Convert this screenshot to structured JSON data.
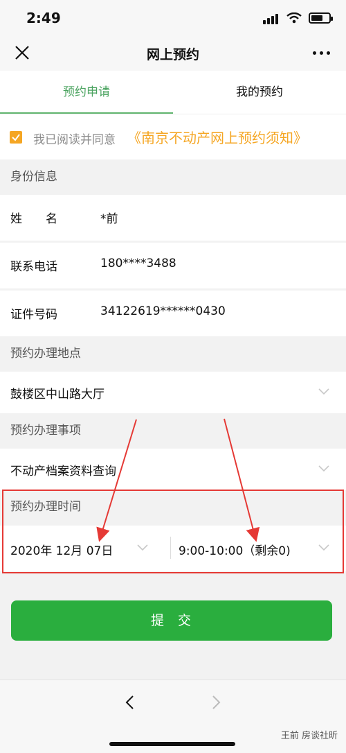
{
  "status": {
    "time": "2:49"
  },
  "navbar": {
    "title": "网上预约"
  },
  "tabs": [
    {
      "label": "预约申请"
    },
    {
      "label": "我的预约"
    }
  ],
  "agreement": {
    "label": "我已阅读并同意",
    "link": "《南京不动产网上预约须知》"
  },
  "identity": {
    "section": "身份信息",
    "name": {
      "label": "姓　　名",
      "value": "*前"
    },
    "phone": {
      "label": "联系电话",
      "value": "180****3488"
    },
    "id": {
      "label": "证件号码",
      "value": "34122619******0430"
    }
  },
  "location": {
    "section": "预约办理地点",
    "value": "鼓楼区中山路大厅"
  },
  "matter": {
    "section": "预约办理事项",
    "value": "不动产档案资料查询"
  },
  "time": {
    "section": "预约办理时间",
    "date": "2020年 12月 07日",
    "slot": "9:00-10:00（剩余0)"
  },
  "submit": {
    "label": "提交"
  },
  "watermark": "王前 房谈社昕",
  "colors": {
    "accent_green": "#2aae3e",
    "tab_green": "#4aa35f",
    "orange": "#f5a623",
    "annotation_red": "#e53935"
  }
}
